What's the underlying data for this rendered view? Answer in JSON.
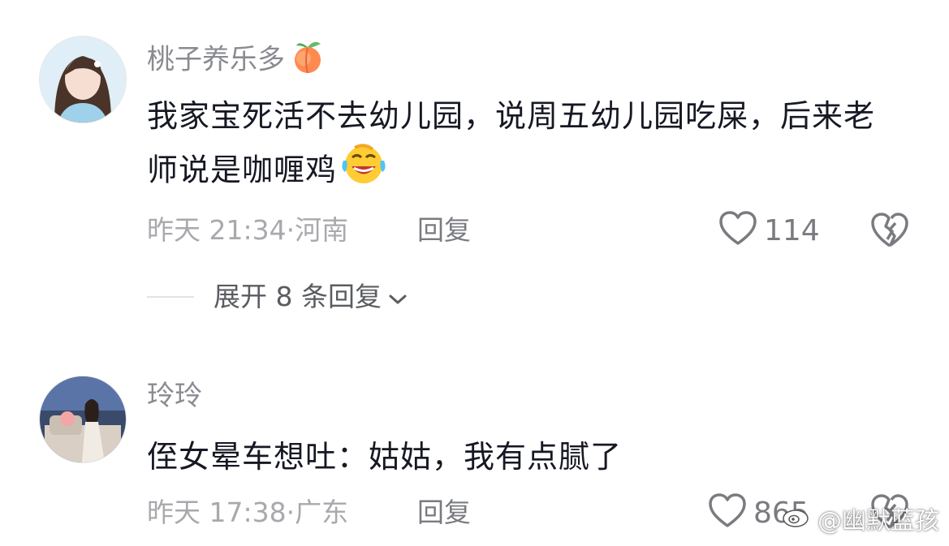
{
  "comments": [
    {
      "username": "桃子养乐多",
      "username_emoji": "peach-emoji",
      "text": "我家宝死活不去幼儿园，说周五幼儿园吃屎，后来老师说是咖喱鸡",
      "text_emoji": "laughing-tears-emoji",
      "time": "昨天 21:34",
      "location": "河南",
      "reply_label": "回复",
      "likes": "114",
      "expand_label": "展开 8 条回复"
    },
    {
      "username": "玲玲",
      "text": "侄女晕车想吐：姑姑，我有点腻了",
      "time": "昨天 17:38",
      "location": "广东",
      "reply_label": "回复",
      "likes": "865"
    }
  ],
  "watermark": {
    "text": "@幽默蓝孩",
    "icon": "weibo-icon"
  },
  "colors": {
    "text": "#161823",
    "secondary": "#8a8b91",
    "meta": "#a8a9ad",
    "action": "#7a7b80"
  },
  "icons": {
    "like": "heart-outline-icon",
    "dislike": "broken-heart-icon",
    "expand": "chevron-down-icon"
  }
}
